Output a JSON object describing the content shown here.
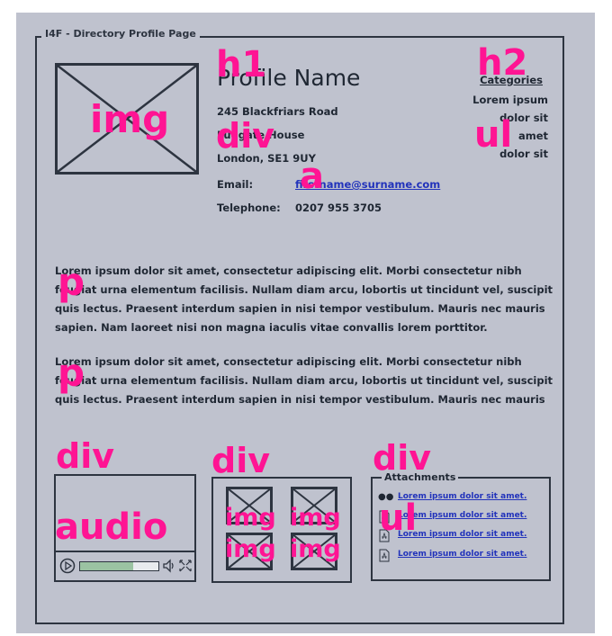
{
  "page": {
    "frame_title": "I4F - Directory Profile Page"
  },
  "profile": {
    "name": "Profile Name",
    "address": [
      "245 Blackfriars Road",
      "Ludgate House",
      "London, SE1 9UY"
    ],
    "email_label": "Email:",
    "email": "firstname@surname.com",
    "telephone_label": "Telephone:",
    "telephone": "0207 955 3705"
  },
  "categories": {
    "heading": "Categories",
    "items": [
      "Lorem ipsum",
      "dolor sit",
      "amet",
      "dolor sit"
    ]
  },
  "paragraphs": [
    [
      "Lorem ipsum dolor sit amet, consectetur adipiscing elit. Morbi consectetur nibh",
      "feugiat urna elementum facilisis. Nullam diam arcu, lobortis ut tincidunt vel, suscipit",
      "quis lectus. Praesent interdum sapien in nisi tempor vestibulum. Mauris nec mauris",
      "sapien. Nam laoreet nisi non magna iaculis vitae convallis lorem porttitor."
    ],
    [
      "Lorem ipsum dolor sit amet, consectetur adipiscing elit. Morbi consectetur nibh",
      "feugiat urna elementum facilisis. Nullam diam arcu, lobortis ut tincidunt vel, suscipit",
      "quis lectus. Praesent interdum sapien in nisi tempor vestibulum. Mauris nec mauris"
    ]
  ],
  "attachments": {
    "legend": "Attachments",
    "items": [
      {
        "label": "Lorem ipsum dolor sit amet.",
        "icon": "audio-file-icon"
      },
      {
        "label": "Lorem ipsum dolor sit amet.",
        "icon": "pdf-file-icon"
      },
      {
        "label": "Lorem ipsum dolor sit amet.",
        "icon": "pdf-file-icon"
      },
      {
        "label": "Lorem ipsum dolor sit amet.",
        "icon": "pdf-file-icon"
      }
    ]
  },
  "audio": {
    "progress": 0.68
  },
  "tags": {
    "h1": "h1",
    "h2": "h2",
    "img": "img",
    "div": "div",
    "a": "a",
    "ul": "ul",
    "p": "p",
    "audio": "audio"
  },
  "colors": {
    "background": "#bfc2ce",
    "ink": "#2d3440",
    "tag": "#ff1493",
    "link": "#2233bb",
    "progress": "#9bc3a2"
  }
}
